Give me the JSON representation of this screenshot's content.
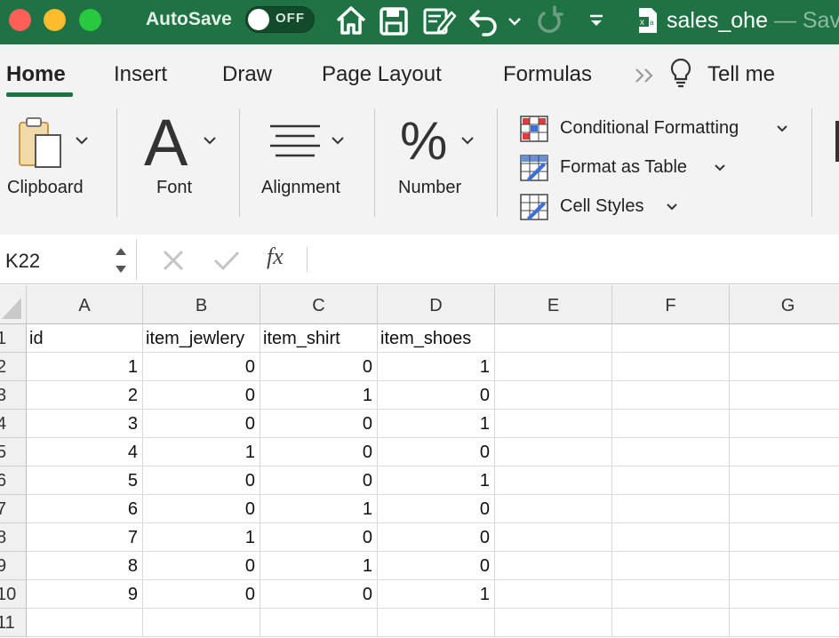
{
  "titlebar": {
    "autosave_label": "AutoSave",
    "autosave_state": "OFF",
    "icons": [
      "home-icon",
      "save-icon",
      "edit-document-icon",
      "undo-icon",
      "chevron-down-icon",
      "redo-icon",
      "customize-toolbar-icon",
      "excel-file-icon"
    ],
    "doc_name": "sales_ohe",
    "doc_suffix": " — Sav",
    "colors": {
      "bar": "#1f7244",
      "close": "#fe5f57",
      "minimize": "#febc2e",
      "maximize": "#28c840"
    }
  },
  "tabs": [
    {
      "label": "Home",
      "active": true
    },
    {
      "label": "Insert"
    },
    {
      "label": "Draw"
    },
    {
      "label": "Page Layout"
    },
    {
      "label": "Formulas"
    },
    {
      "label": "Tell me"
    }
  ],
  "ribbon": {
    "clipboard": "Clipboard",
    "font": "Font",
    "font_glyph": "A",
    "alignment": "Alignment",
    "number": "Number",
    "number_glyph": "%",
    "conditional_formatting": "Conditional Formatting",
    "format_as_table": "Format as Table",
    "cell_styles": "Cell Styles"
  },
  "formula_bar": {
    "name_box": "K22",
    "fx": "fx",
    "value": ""
  },
  "sheet": {
    "columns": [
      "A",
      "B",
      "C",
      "D",
      "E",
      "F",
      "G"
    ],
    "row_numbers": [
      "1",
      "2",
      "3",
      "4",
      "5",
      "6",
      "7",
      "8",
      "9",
      "10",
      "11"
    ],
    "rows": [
      [
        "id",
        "item_jewlery",
        "item_shirt",
        "item_shoes"
      ],
      [
        "1",
        "0",
        "0",
        "1"
      ],
      [
        "2",
        "0",
        "1",
        "0"
      ],
      [
        "3",
        "0",
        "0",
        "1"
      ],
      [
        "4",
        "1",
        "0",
        "0"
      ],
      [
        "5",
        "0",
        "0",
        "1"
      ],
      [
        "6",
        "0",
        "1",
        "0"
      ],
      [
        "7",
        "1",
        "0",
        "0"
      ],
      [
        "8",
        "0",
        "1",
        "0"
      ],
      [
        "9",
        "0",
        "0",
        "1"
      ],
      [
        "",
        "",
        "",
        ""
      ]
    ]
  }
}
